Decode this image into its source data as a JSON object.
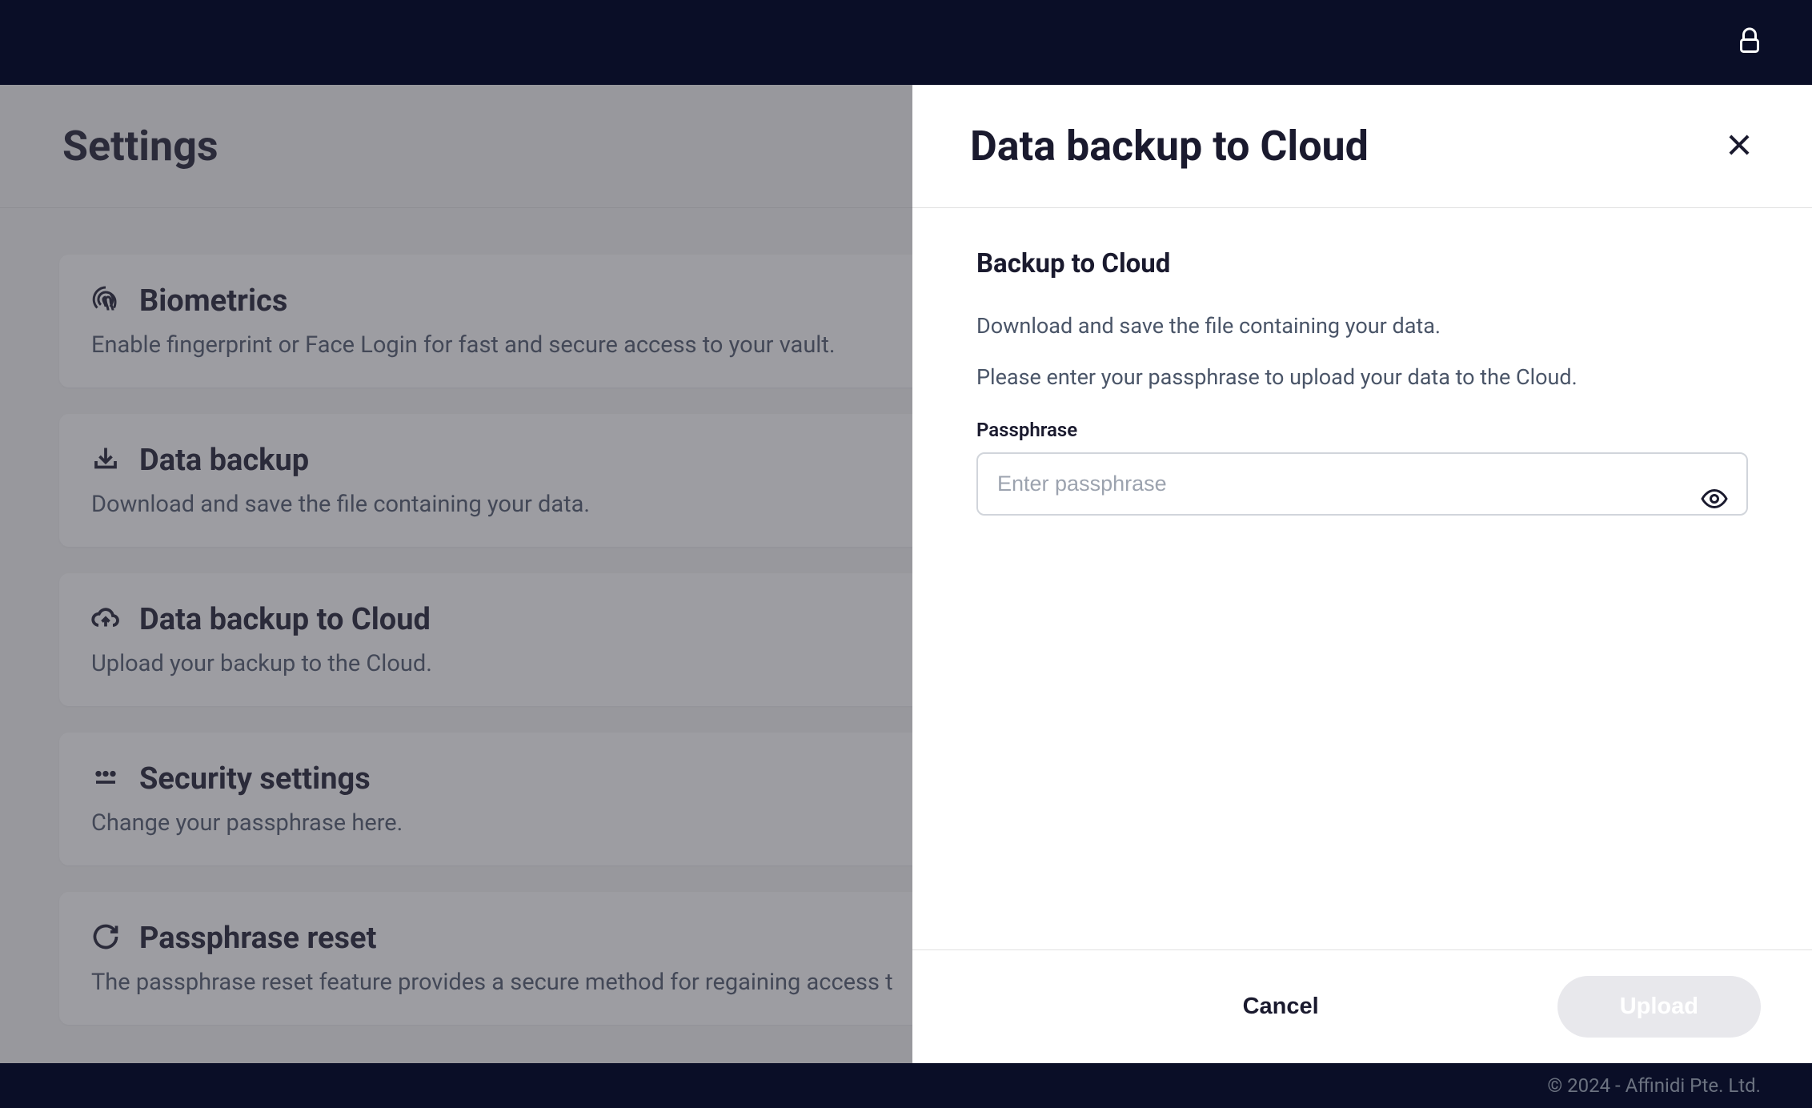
{
  "header": {
    "lock_aria": "Lock"
  },
  "page": {
    "title": "Settings"
  },
  "settings": {
    "items": [
      {
        "title": "Biometrics",
        "desc": "Enable fingerprint or Face Login for fast and secure access to your vault.",
        "icon": "fingerprint"
      },
      {
        "title": "Data backup",
        "desc": "Download and save the file containing your data.",
        "icon": "download"
      },
      {
        "title": "Data backup to Cloud",
        "desc": "Upload your backup to the Cloud.",
        "icon": "cloud"
      },
      {
        "title": "Security settings",
        "desc": "Change your passphrase here.",
        "icon": "password"
      },
      {
        "title": "Passphrase reset",
        "desc": "The passphrase reset feature provides a secure method for regaining access t",
        "icon": "refresh"
      }
    ]
  },
  "panel": {
    "title": "Data backup to Cloud",
    "subtitle": "Backup to Cloud",
    "text1": "Download and save the file containing your data.",
    "text2": "Please enter your passphrase to upload your data to the Cloud.",
    "field_label": "Passphrase",
    "placeholder": "Enter passphrase",
    "cancel_label": "Cancel",
    "upload_label": "Upload"
  },
  "footer": {
    "copyright": "© 2024 - Affinidi Pte. Ltd."
  }
}
